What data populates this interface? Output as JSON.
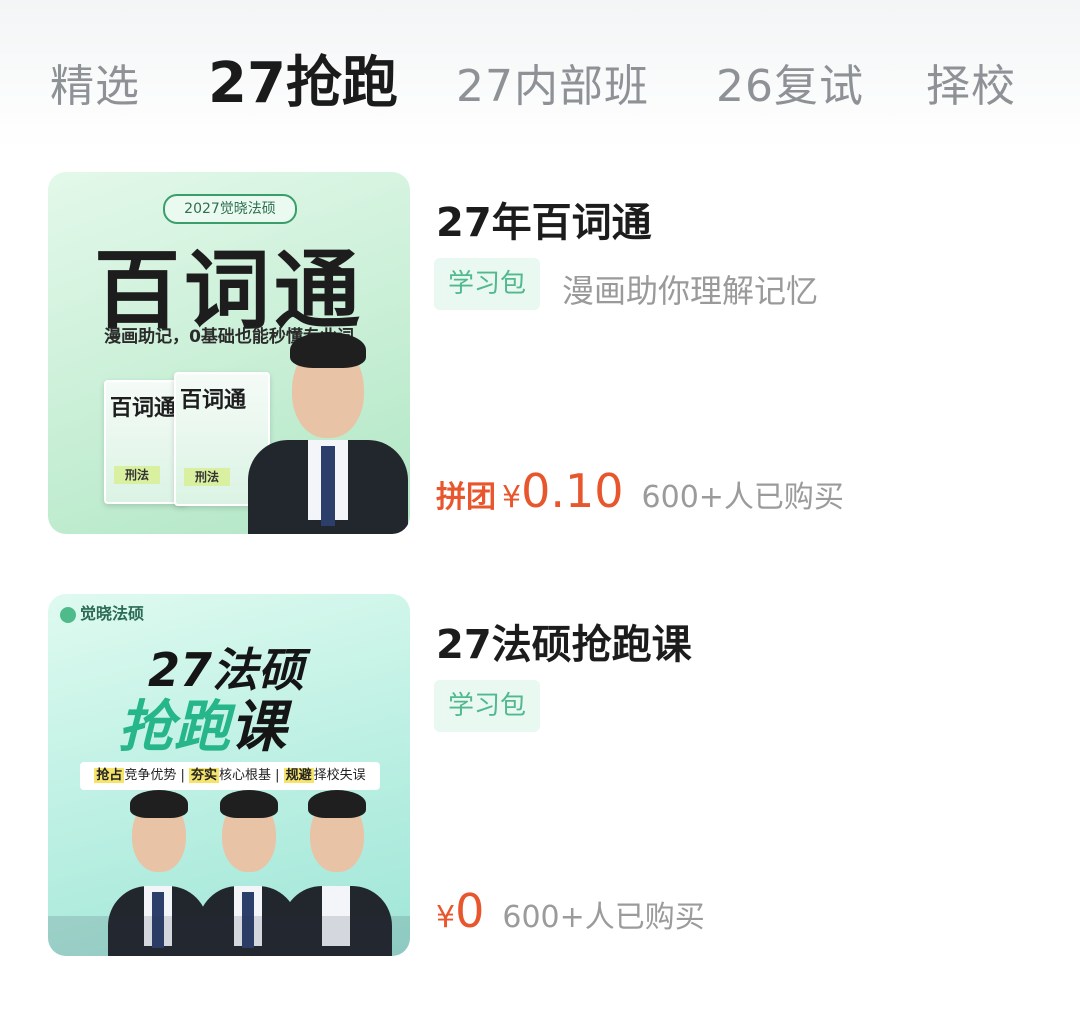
{
  "tabs": [
    {
      "label": "精选",
      "active": false
    },
    {
      "label": "27抢跑",
      "active": true
    },
    {
      "label": "27内部班",
      "active": false
    },
    {
      "label": "26复试",
      "active": false
    },
    {
      "label": "择校",
      "active": false
    }
  ],
  "products": [
    {
      "title": "27年百词通",
      "tag": "学习包",
      "desc": "漫画助你理解记忆",
      "price_label": "拼团",
      "currency": "¥",
      "price": "0.10",
      "sold": "600+人已购买",
      "thumb": {
        "brand": "2027觉晓法硕",
        "big_text": "百词通",
        "subtitle": "漫画助记，0基础也能秒懂专业词",
        "book_title": "百词通",
        "book_sub": "刑法"
      }
    },
    {
      "title": "27法硕抢跑课",
      "tag": "学习包",
      "desc": "",
      "price_label": "",
      "currency": "¥",
      "price": "0",
      "sold": "600+人已购买",
      "thumb": {
        "logo": "觉晓法硕",
        "line1": "27法硕",
        "line2a": "抢跑",
        "line2b": "课",
        "banner_1b": "抢占",
        "banner_1": "竞争优势 | ",
        "banner_2b": "夯实",
        "banner_2": "核心根基 | ",
        "banner_3b": "规避",
        "banner_3": "择校失误"
      }
    }
  ],
  "colors": {
    "accent_price": "#e8562e",
    "tag_bg": "#e9f8f1",
    "tag_text": "#52b98f"
  }
}
